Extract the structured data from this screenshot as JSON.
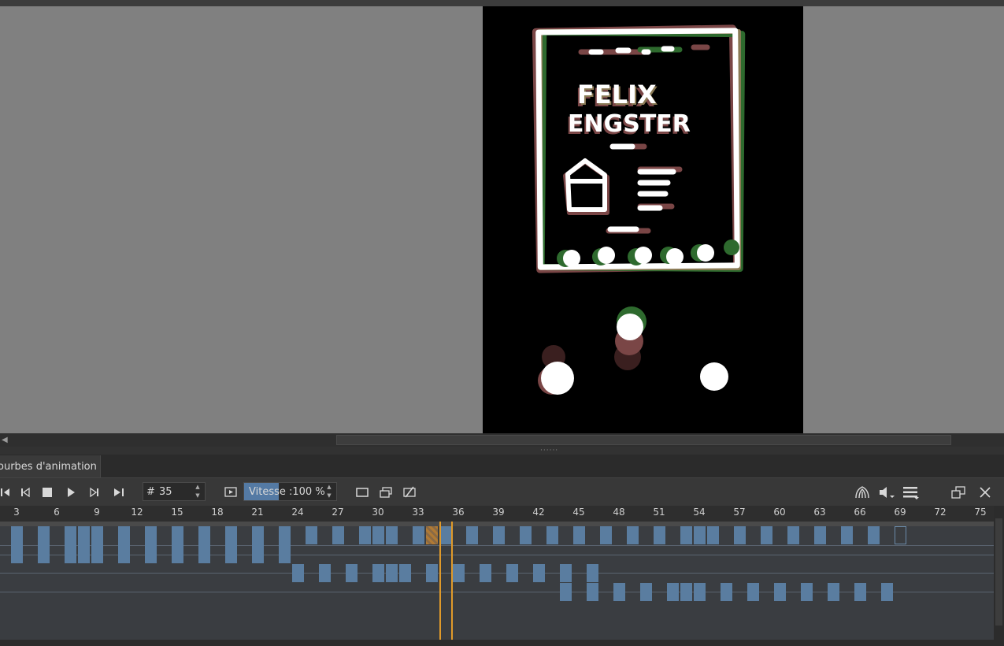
{
  "docker_tab": {
    "label": "ourbes d'animation"
  },
  "toolbar": {
    "frame_hash": "#",
    "current_frame": "35",
    "speed_label": "Vitesse :100 %"
  },
  "ruler": {
    "labels": [
      "3",
      "6",
      "9",
      "12",
      "15",
      "18",
      "21",
      "24",
      "27",
      "30",
      "33",
      "36",
      "39",
      "42",
      "45",
      "48",
      "51",
      "54",
      "57",
      "60",
      "63",
      "66",
      "69",
      "72",
      "75"
    ]
  },
  "drawing": {
    "title_line1": "FELIX",
    "title_line2": "ENGSTER"
  },
  "colors": {
    "canvas_bg": "#808080",
    "document_bg": "#000000",
    "keyframe": "#5a7da0",
    "playhead": "#e09a2a",
    "speed_fill": "#547aa4"
  },
  "icons": {
    "first_frame": "skip-start-icon",
    "prev_keyframe": "prev-frame-icon",
    "stop": "stop-icon",
    "play": "play-icon",
    "next_keyframe": "next-frame-icon",
    "last_frame": "skip-end-icon",
    "onion": "onion-skin-icon",
    "audio": "speaker-icon",
    "menu": "hamburger-icon",
    "float": "float-window-icon",
    "close": "close-icon"
  }
}
